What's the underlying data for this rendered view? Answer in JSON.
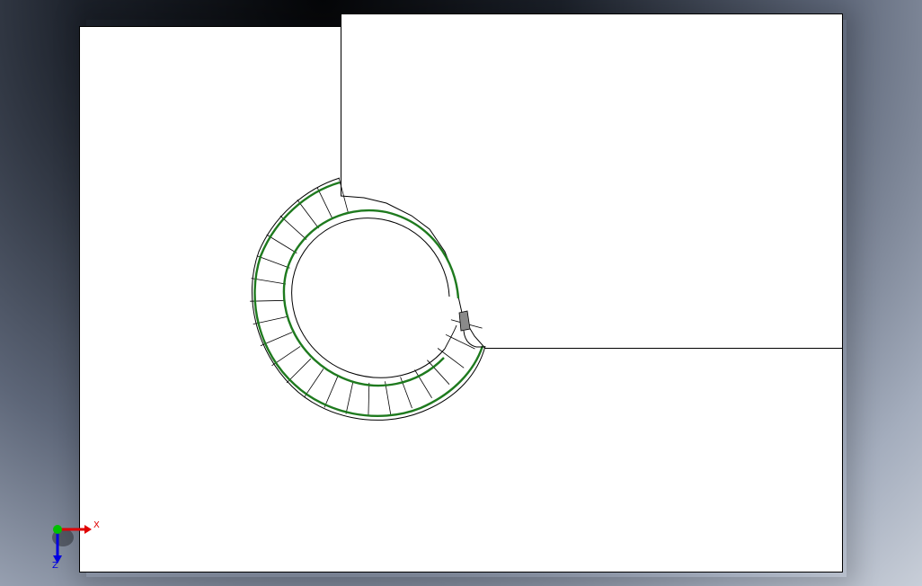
{
  "viewport": {
    "background": "gradient-gray-blue"
  },
  "model": {
    "part": "helical-spring-with-blocks",
    "colors": {
      "edge": "#000000",
      "helix": "#1e7a1e",
      "face": "#ffffff",
      "shaded-face": "#8a8a8a"
    }
  },
  "triad": {
    "x_label": "X",
    "z_label": "Z",
    "colors": {
      "x": "#e00000",
      "y": "#00c000",
      "z": "#0000e0"
    }
  }
}
